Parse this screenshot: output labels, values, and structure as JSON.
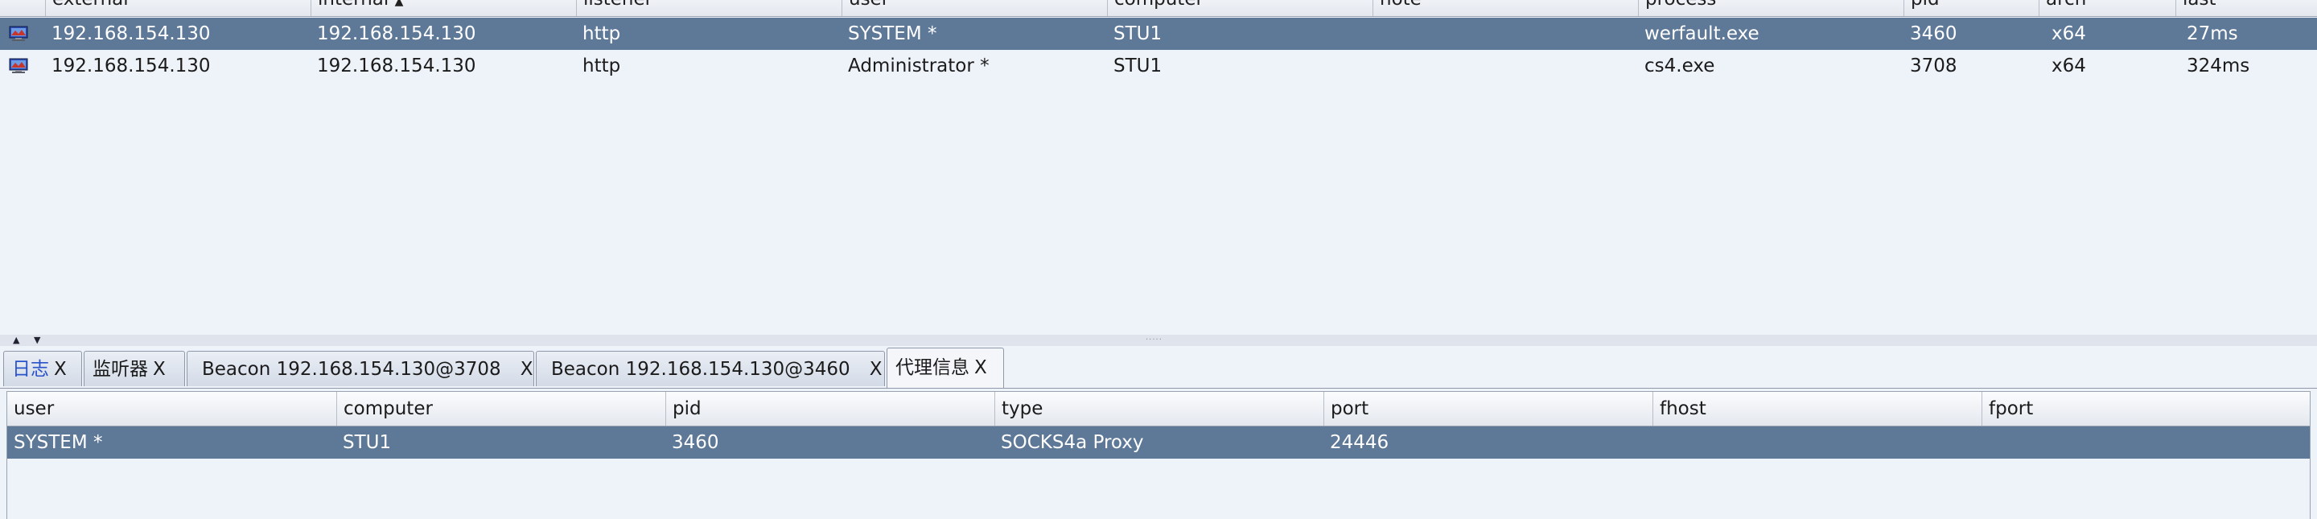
{
  "beacons_table": {
    "columns": [
      "external",
      "internal",
      "listener",
      "user",
      "computer",
      "note",
      "process",
      "pid",
      "arch",
      "last"
    ],
    "sort_indicator": "▲",
    "rows": [
      {
        "external": "192.168.154.130",
        "internal": "192.168.154.130",
        "listener": "http",
        "user": "SYSTEM *",
        "computer": "STU1",
        "note": "",
        "process": "werfault.exe",
        "pid": "3460",
        "arch": "x64",
        "last": "27ms",
        "selected": true
      },
      {
        "external": "192.168.154.130",
        "internal": "192.168.154.130",
        "listener": "http",
        "user": "Administrator *",
        "computer": "STU1",
        "note": "",
        "process": "cs4.exe",
        "pid": "3708",
        "arch": "x64",
        "last": "324ms",
        "selected": false
      }
    ]
  },
  "splitter": {
    "up_arrow": "▲",
    "down_arrow": "▼",
    "grip": "·····"
  },
  "tabs": [
    {
      "label": "日志",
      "close": "X"
    },
    {
      "label": "监听器",
      "close": "X"
    },
    {
      "label": "Beacon 192.168.154.130@3708",
      "close": "X"
    },
    {
      "label": "Beacon 192.168.154.130@3460",
      "close": "X"
    },
    {
      "label": "代理信息",
      "close": "X",
      "active": true
    }
  ],
  "proxy_table": {
    "columns": [
      "user",
      "computer",
      "pid",
      "type",
      "port",
      "fhost",
      "fport"
    ],
    "rows": [
      {
        "user": "SYSTEM *",
        "computer": "STU1",
        "pid": "3460",
        "type": "SOCKS4a Proxy",
        "port": "24446",
        "fhost": "",
        "fport": ""
      }
    ]
  },
  "colors": {
    "selection": "#5e7898",
    "background": "#eef2f9",
    "tab_highlight_text": "#2a52c9"
  },
  "icons": [
    "beacon-computer-icon"
  ]
}
